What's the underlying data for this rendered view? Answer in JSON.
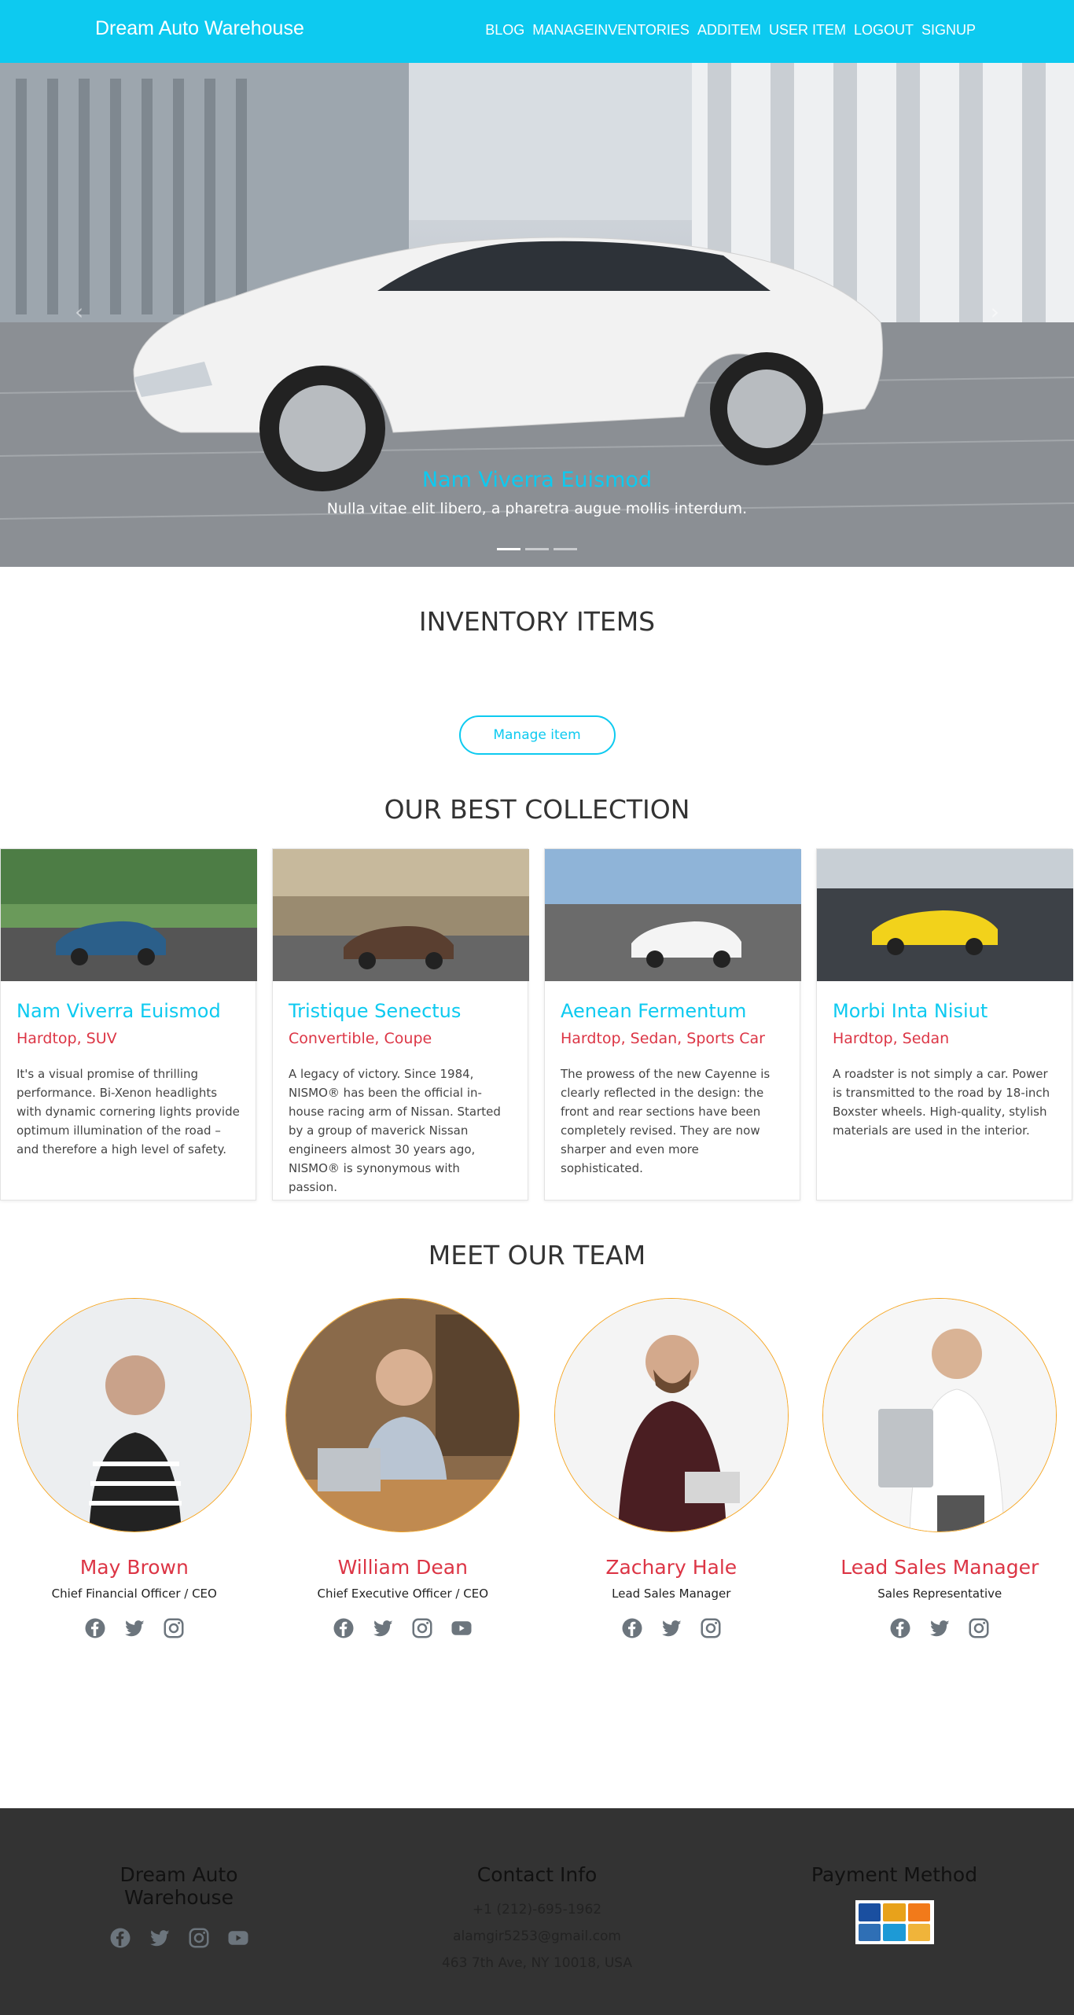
{
  "nav": {
    "brand": "Dream Auto Warehouse",
    "links": [
      "BLOG",
      "MANAGEINVENTORIES",
      "ADDITEM",
      "USER ITEM",
      "LOGOUT",
      "SIGNUP"
    ]
  },
  "hero": {
    "title": "Nam Viverra Euismod",
    "subtitle": "Nulla vitae elit libero, a pharetra augue mollis interdum.",
    "prev_icon": "chevron-left-icon",
    "next_icon": "chevron-right-icon",
    "slides": 3,
    "active_slide": 1
  },
  "inventory": {
    "title": "INVENTORY ITEMS",
    "button": "Manage item"
  },
  "collection": {
    "title": "OUR BEST COLLECTION",
    "cards": [
      {
        "name": "Nam Viverra Euismod",
        "tags": "Hardtop, SUV",
        "desc": "It's a visual promise of thrilling performance. Bi-Xenon headlights with dynamic cornering lights provide optimum illumination of the road – and therefore a high level of safety."
      },
      {
        "name": "Tristique Senectus",
        "tags": "Convertible, Coupe",
        "desc": "A legacy of victory. Since 1984, NISMO® has been the official in-house racing arm of Nissan. Started by a group of maverick Nissan engineers almost 30 years ago, NISMO® is synonymous with passion."
      },
      {
        "name": "Aenean Fermentum",
        "tags": "Hardtop, Sedan, Sports Car",
        "desc": "The prowess of the new Cayenne is clearly reflected in the design: the front and rear sections have been completely revised. They are now sharper and even more sophisticated."
      },
      {
        "name": "Morbi Inta Nisiut",
        "tags": "Hardtop, Sedan",
        "desc": "A roadster is not simply a car. Power is transmitted to the road by 18-inch Boxster wheels. High-quality, stylish materials are used in the interior."
      }
    ]
  },
  "team": {
    "title": "MEET OUR TEAM",
    "members": [
      {
        "name": "May Brown",
        "role": "Chief Financial Officer / CEO",
        "icons": [
          "facebook-icon",
          "twitter-icon",
          "instagram-icon"
        ]
      },
      {
        "name": "William Dean",
        "role": "Chief Executive Officer / CEO",
        "icons": [
          "facebook-icon",
          "twitter-icon",
          "instagram-icon",
          "youtube-icon"
        ]
      },
      {
        "name": "Zachary Hale",
        "role": "Lead Sales Manager",
        "icons": [
          "facebook-icon",
          "twitter-icon",
          "instagram-icon"
        ]
      },
      {
        "name": "Lead Sales Manager",
        "role": "Sales Representative",
        "icons": [
          "facebook-icon",
          "twitter-icon",
          "instagram-icon"
        ]
      }
    ]
  },
  "footer": {
    "brand": "Dream Auto Warehouse",
    "contact_title": "Contact Info",
    "phone": "+1 (212)-695-1962",
    "email": "alamgir5253@gmail.com",
    "address": "463 7th Ave, NY 10018, USA",
    "payment_title": "Payment Method",
    "icons": [
      "facebook-icon",
      "twitter-icon",
      "instagram-icon",
      "youtube-icon"
    ]
  },
  "colors": {
    "accent": "#0dcaf0",
    "danger": "#dc3545",
    "footer_bg": "#333333",
    "avatar_border": "#f5a623"
  }
}
